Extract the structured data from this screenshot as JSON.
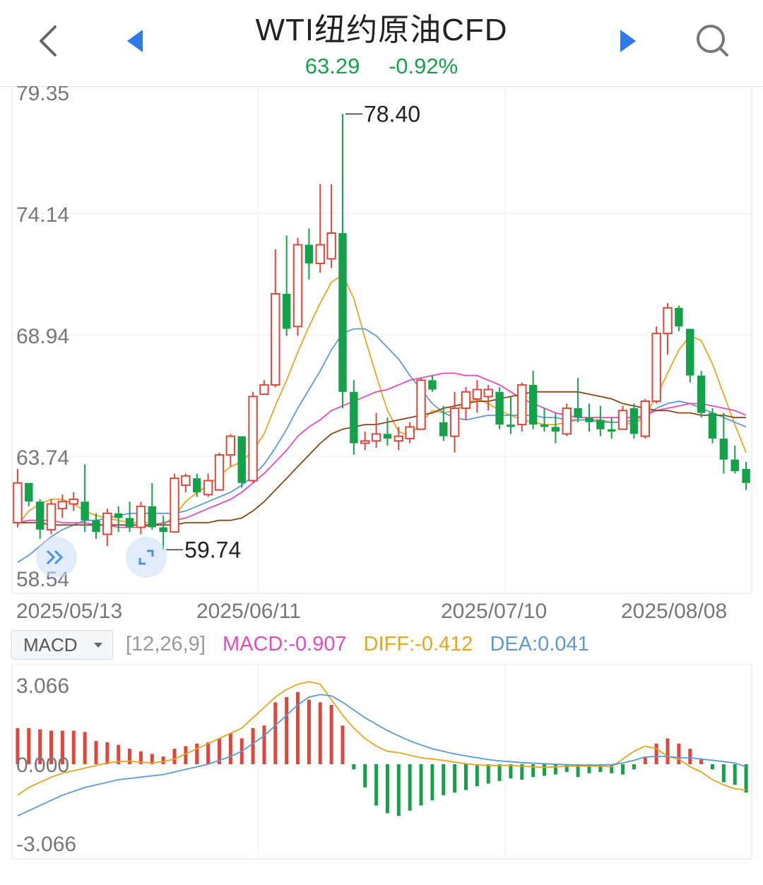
{
  "header": {
    "title": "WTI纽约原油CFD",
    "price": "63.29",
    "change_pct": "-0.92%",
    "icons": [
      "back-icon",
      "prev-arrow-icon",
      "next-arrow-icon",
      "search-icon"
    ]
  },
  "colors": {
    "up": "#e0473c",
    "down": "#13a24a",
    "ma5": "#eaa51c",
    "ma10": "#5b9ad6",
    "ma20": "#e54bc0",
    "ma30": "#8b4513"
  },
  "indicator": {
    "selected": "MACD",
    "params": "[12,26,9]",
    "macd_label": "MACD:-0.907",
    "diff_label": "DIFF:-0.412",
    "dea_label": "DEA:0.041"
  },
  "floating_buttons": [
    "expand-panel-icon",
    "fullscreen-icon"
  ],
  "chart_data": [
    {
      "type": "candlestick",
      "title": "WTI纽约原油CFD",
      "y_ticks": [
        "79.35",
        "74.14",
        "68.94",
        "63.74",
        "58.54"
      ],
      "ylim": [
        58.54,
        79.35
      ],
      "x_ticks": [
        "2025/05/13",
        "2025/06/11",
        "2025/07/10",
        "2025/08/08"
      ],
      "max_label": "78.40",
      "min_label": "59.74",
      "grid": true,
      "candles": [
        {
          "o": 60.9,
          "h": 63.2,
          "l": 60.7,
          "c": 62.6
        },
        {
          "o": 62.6,
          "h": 62.6,
          "l": 61.6,
          "c": 61.8
        },
        {
          "o": 61.8,
          "h": 61.9,
          "l": 60.2,
          "c": 60.6
        },
        {
          "o": 60.6,
          "h": 61.9,
          "l": 60.4,
          "c": 61.7
        },
        {
          "o": 61.5,
          "h": 62.1,
          "l": 61.1,
          "c": 61.8
        },
        {
          "o": 61.7,
          "h": 62.2,
          "l": 61.4,
          "c": 61.9
        },
        {
          "o": 61.8,
          "h": 63.4,
          "l": 60.5,
          "c": 61.0
        },
        {
          "o": 61.0,
          "h": 61.3,
          "l": 60.2,
          "c": 60.5
        },
        {
          "o": 60.4,
          "h": 61.5,
          "l": 59.9,
          "c": 61.3
        },
        {
          "o": 61.3,
          "h": 61.6,
          "l": 60.5,
          "c": 61.1
        },
        {
          "o": 61.1,
          "h": 61.8,
          "l": 60.5,
          "c": 60.7
        },
        {
          "o": 60.7,
          "h": 61.8,
          "l": 60.4,
          "c": 61.6
        },
        {
          "o": 61.6,
          "h": 62.6,
          "l": 60.6,
          "c": 60.7
        },
        {
          "o": 60.7,
          "h": 61.2,
          "l": 59.74,
          "c": 60.5
        },
        {
          "o": 60.5,
          "h": 63.0,
          "l": 60.5,
          "c": 62.8
        },
        {
          "o": 62.5,
          "h": 63.0,
          "l": 62.2,
          "c": 62.9
        },
        {
          "o": 62.8,
          "h": 63.0,
          "l": 62.0,
          "c": 62.2
        },
        {
          "o": 62.1,
          "h": 63.0,
          "l": 62.0,
          "c": 62.7
        },
        {
          "o": 62.3,
          "h": 63.9,
          "l": 62.3,
          "c": 63.8
        },
        {
          "o": 63.8,
          "h": 64.7,
          "l": 63.3,
          "c": 64.6
        },
        {
          "o": 64.6,
          "h": 64.6,
          "l": 62.4,
          "c": 62.6
        },
        {
          "o": 62.7,
          "h": 66.5,
          "l": 62.6,
          "c": 66.3
        },
        {
          "o": 66.4,
          "h": 67.0,
          "l": 66.4,
          "c": 66.8
        },
        {
          "o": 66.8,
          "h": 72.6,
          "l": 66.7,
          "c": 70.7
        },
        {
          "o": 70.7,
          "h": 73.2,
          "l": 68.9,
          "c": 69.2
        },
        {
          "o": 69.3,
          "h": 73.1,
          "l": 68.9,
          "c": 72.8
        },
        {
          "o": 72.8,
          "h": 73.5,
          "l": 71.3,
          "c": 72.0
        },
        {
          "o": 72.0,
          "h": 75.4,
          "l": 71.6,
          "c": 72.8
        },
        {
          "o": 72.2,
          "h": 75.4,
          "l": 71.8,
          "c": 73.3
        },
        {
          "o": 73.3,
          "h": 78.4,
          "l": 65.8,
          "c": 66.5
        },
        {
          "o": 66.5,
          "h": 67.0,
          "l": 63.8,
          "c": 64.3
        },
        {
          "o": 64.3,
          "h": 64.8,
          "l": 64.0,
          "c": 64.4
        },
        {
          "o": 64.4,
          "h": 65.6,
          "l": 64.1,
          "c": 64.7
        },
        {
          "o": 64.7,
          "h": 65.4,
          "l": 64.2,
          "c": 64.5
        },
        {
          "o": 64.4,
          "h": 65.0,
          "l": 64.0,
          "c": 64.6
        },
        {
          "o": 64.5,
          "h": 65.2,
          "l": 64.3,
          "c": 65.0
        },
        {
          "o": 64.9,
          "h": 67.1,
          "l": 64.9,
          "c": 67.0
        },
        {
          "o": 67.0,
          "h": 67.2,
          "l": 66.5,
          "c": 66.6
        },
        {
          "o": 65.2,
          "h": 65.9,
          "l": 64.4,
          "c": 64.6
        },
        {
          "o": 64.6,
          "h": 66.5,
          "l": 63.9,
          "c": 65.8
        },
        {
          "o": 65.8,
          "h": 66.7,
          "l": 65.3,
          "c": 66.5
        },
        {
          "o": 66.2,
          "h": 67.0,
          "l": 65.6,
          "c": 66.6
        },
        {
          "o": 66.3,
          "h": 66.8,
          "l": 65.7,
          "c": 66.6
        },
        {
          "o": 66.5,
          "h": 66.7,
          "l": 64.9,
          "c": 65.1
        },
        {
          "o": 65.1,
          "h": 66.3,
          "l": 64.7,
          "c": 65.0
        },
        {
          "o": 65.1,
          "h": 66.9,
          "l": 64.8,
          "c": 66.8
        },
        {
          "o": 66.8,
          "h": 67.4,
          "l": 64.9,
          "c": 65.1
        },
        {
          "o": 65.1,
          "h": 65.8,
          "l": 64.8,
          "c": 65.0
        },
        {
          "o": 65.0,
          "h": 65.6,
          "l": 64.3,
          "c": 64.8
        },
        {
          "o": 64.7,
          "h": 66.0,
          "l": 64.6,
          "c": 65.8
        },
        {
          "o": 65.8,
          "h": 67.1,
          "l": 65.2,
          "c": 65.4
        },
        {
          "o": 65.4,
          "h": 66.0,
          "l": 64.8,
          "c": 65.2
        },
        {
          "o": 65.3,
          "h": 65.9,
          "l": 64.6,
          "c": 64.9
        },
        {
          "o": 64.9,
          "h": 65.4,
          "l": 64.5,
          "c": 64.8
        },
        {
          "o": 64.9,
          "h": 65.9,
          "l": 64.9,
          "c": 65.7
        },
        {
          "o": 65.8,
          "h": 66.0,
          "l": 64.5,
          "c": 64.7
        },
        {
          "o": 64.6,
          "h": 66.2,
          "l": 64.5,
          "c": 66.1
        },
        {
          "o": 66.1,
          "h": 69.3,
          "l": 66.0,
          "c": 69.0
        },
        {
          "o": 69.0,
          "h": 70.3,
          "l": 68.1,
          "c": 70.1
        },
        {
          "o": 70.1,
          "h": 70.2,
          "l": 69.1,
          "c": 69.3
        },
        {
          "o": 69.2,
          "h": 69.2,
          "l": 66.9,
          "c": 67.2
        },
        {
          "o": 67.2,
          "h": 67.4,
          "l": 65.4,
          "c": 65.6
        },
        {
          "o": 65.6,
          "h": 65.8,
          "l": 64.3,
          "c": 64.5
        },
        {
          "o": 64.5,
          "h": 65.6,
          "l": 63.0,
          "c": 63.6
        },
        {
          "o": 63.6,
          "h": 64.2,
          "l": 63.0,
          "c": 63.1
        },
        {
          "o": 63.2,
          "h": 63.5,
          "l": 62.3,
          "c": 62.6
        }
      ],
      "ma_series": [
        {
          "key": "ma5",
          "values": [
            60.8,
            61.4,
            61.7,
            61.9,
            61.9,
            61.7,
            61.4,
            61.2,
            61.1,
            61.0,
            60.9,
            60.9,
            60.9,
            60.8,
            61.2,
            61.8,
            62.2,
            62.5,
            62.9,
            63.3,
            63.5,
            64.0,
            64.7,
            65.9,
            67.0,
            68.2,
            69.3,
            70.3,
            71.2,
            71.5,
            70.5,
            68.8,
            67.2,
            65.7,
            64.8,
            64.6,
            65.2,
            65.7,
            65.6,
            65.7,
            66.0,
            66.2,
            66.0,
            65.7,
            65.5,
            65.3,
            65.2,
            65.1,
            65.1,
            65.2,
            65.3,
            65.3,
            65.3,
            65.2,
            65.2,
            65.1,
            65.5,
            66.3,
            67.3,
            68.3,
            68.9,
            68.7,
            67.7,
            66.4,
            65.1,
            63.9
          ]
        },
        {
          "key": "ma10",
          "values": [
            59.2,
            59.5,
            59.9,
            60.3,
            60.6,
            60.8,
            61.0,
            61.0,
            61.1,
            61.2,
            61.3,
            61.3,
            61.3,
            61.3,
            61.3,
            61.4,
            61.6,
            61.8,
            62.0,
            62.2,
            62.5,
            62.9,
            63.4,
            64.1,
            64.9,
            65.8,
            66.6,
            67.4,
            68.3,
            69.0,
            69.2,
            69.2,
            68.9,
            68.4,
            67.9,
            67.2,
            66.6,
            66.0,
            65.6,
            65.4,
            65.3,
            65.4,
            65.5,
            65.5,
            65.5,
            65.5,
            65.5,
            65.4,
            65.4,
            65.3,
            65.3,
            65.3,
            65.2,
            65.2,
            65.2,
            65.3,
            65.5,
            65.8,
            66.0,
            66.1,
            66.0,
            65.8,
            65.6,
            65.4,
            65.2,
            65.0
          ]
        },
        {
          "key": "ma20",
          "values": [
            60.9,
            61.0,
            61.0,
            61.0,
            60.9,
            60.9,
            60.9,
            60.8,
            60.8,
            60.7,
            60.7,
            60.7,
            60.8,
            60.9,
            61.0,
            61.1,
            61.3,
            61.5,
            61.7,
            61.9,
            62.2,
            62.6,
            63.0,
            63.5,
            64.0,
            64.6,
            65.0,
            65.3,
            65.7,
            65.9,
            66.1,
            66.3,
            66.5,
            66.6,
            66.8,
            67.0,
            67.1,
            67.2,
            67.3,
            67.3,
            67.2,
            67.2,
            67.0,
            66.8,
            66.5,
            66.2,
            66.0,
            65.8,
            65.6,
            65.5,
            65.4,
            65.4,
            65.4,
            65.4,
            65.4,
            65.4,
            65.5,
            65.7,
            65.8,
            65.9,
            66.0,
            66.0,
            65.9,
            65.8,
            65.7,
            65.5
          ]
        },
        {
          "key": "ma30",
          "values": [
            60.9,
            60.9,
            60.9,
            60.8,
            60.8,
            60.8,
            60.8,
            60.8,
            60.8,
            60.8,
            60.8,
            60.8,
            60.8,
            60.8,
            60.8,
            60.9,
            60.9,
            60.9,
            61.0,
            61.0,
            61.1,
            61.4,
            61.8,
            62.3,
            62.8,
            63.3,
            63.8,
            64.3,
            64.7,
            64.9,
            65.0,
            65.1,
            65.1,
            65.2,
            65.3,
            65.4,
            65.5,
            65.6,
            65.8,
            65.9,
            66.0,
            66.1,
            66.1,
            66.2,
            66.3,
            66.4,
            66.5,
            66.5,
            66.5,
            66.5,
            66.5,
            66.4,
            66.3,
            66.2,
            66.0,
            65.9,
            65.8,
            65.7,
            65.7,
            65.6,
            65.6,
            65.5,
            65.5,
            65.5,
            65.4,
            65.4
          ]
        }
      ]
    },
    {
      "type": "bar+line",
      "title": "MACD",
      "y_ticks": [
        "3.066",
        "0.000",
        "-3.066"
      ],
      "ylim": [
        -3.066,
        3.066
      ],
      "series": [
        {
          "name": "MACD",
          "values": [
            1.4,
            1.4,
            1.35,
            1.3,
            1.3,
            1.3,
            1.25,
            0.9,
            0.85,
            0.75,
            0.6,
            0.5,
            0.4,
            0.3,
            0.6,
            0.7,
            0.8,
            0.85,
            1.0,
            1.2,
            1.0,
            1.4,
            1.5,
            2.4,
            2.6,
            2.8,
            2.5,
            2.4,
            2.3,
            1.5,
            -0.2,
            -0.9,
            -1.6,
            -1.9,
            -2.0,
            -1.8,
            -1.6,
            -1.4,
            -1.2,
            -1.1,
            -1.0,
            -0.85,
            -0.75,
            -0.65,
            -0.55,
            -0.6,
            -0.5,
            -0.45,
            -0.4,
            -0.3,
            -0.5,
            -0.35,
            -0.3,
            -0.35,
            -0.4,
            -0.2,
            0.3,
            0.8,
            1.0,
            0.8,
            0.6,
            0.2,
            -0.2,
            -0.7,
            -0.8,
            -1.1
          ]
        },
        {
          "name": "DIFF",
          "values": [
            -1.2,
            -0.9,
            -0.7,
            -0.5,
            -0.35,
            -0.25,
            -0.15,
            -0.05,
            0.05,
            0.1,
            0.12,
            0.08,
            0.05,
            0.1,
            0.2,
            0.4,
            0.6,
            0.8,
            1.0,
            1.2,
            1.4,
            1.8,
            2.2,
            2.6,
            2.9,
            3.1,
            3.2,
            3.1,
            2.5,
            1.9,
            1.4,
            1.0,
            0.7,
            0.5,
            0.45,
            0.35,
            0.25,
            0.2,
            0.15,
            0.08,
            0.02,
            -0.03,
            -0.05,
            -0.05,
            -0.04,
            -0.08,
            -0.1,
            -0.12,
            -0.1,
            -0.08,
            -0.07,
            -0.08,
            -0.07,
            -0.1,
            0.2,
            0.5,
            0.7,
            0.6,
            0.3,
            0.2,
            -0.1,
            -0.3,
            -0.6,
            -0.8,
            -0.95,
            -1.0
          ]
        },
        {
          "name": "DEA",
          "values": [
            -2.0,
            -1.8,
            -1.6,
            -1.4,
            -1.2,
            -1.05,
            -0.9,
            -0.8,
            -0.7,
            -0.6,
            -0.55,
            -0.5,
            -0.45,
            -0.4,
            -0.3,
            -0.2,
            -0.1,
            0.0,
            0.15,
            0.3,
            0.5,
            0.8,
            1.1,
            1.5,
            1.9,
            2.3,
            2.6,
            2.7,
            2.65,
            2.4,
            2.1,
            1.8,
            1.55,
            1.3,
            1.1,
            0.9,
            0.75,
            0.6,
            0.5,
            0.4,
            0.32,
            0.25,
            0.18,
            0.13,
            0.1,
            0.06,
            0.04,
            0.02,
            0.0,
            -0.02,
            -0.03,
            -0.03,
            -0.03,
            -0.02,
            0.05,
            0.15,
            0.28,
            0.3,
            0.3,
            0.25,
            0.25,
            0.2,
            0.15,
            0.1,
            0.05,
            -0.1
          ]
        }
      ]
    }
  ]
}
